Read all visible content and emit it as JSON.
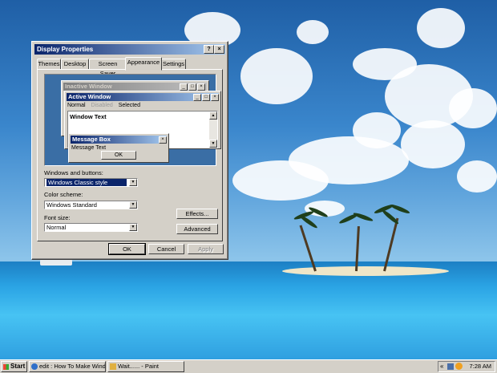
{
  "window": {
    "title": "Display Properties",
    "help_btn": "?",
    "close_btn": "×",
    "tabs": [
      "Themes",
      "Desktop",
      "Screen Saver",
      "Appearance",
      "Settings"
    ],
    "active_tab": "Appearance"
  },
  "preview": {
    "inactive_title": "Inactive Window",
    "active_title": "Active Window",
    "menu": [
      "Normal",
      "Disabled",
      "Selected"
    ],
    "window_text": "Window Text",
    "msgbox_title": "Message Box",
    "msgbox_text": "Message Text",
    "msgbox_ok": "OK"
  },
  "form": {
    "windows_buttons_label": "Windows and buttons:",
    "windows_buttons_value": "Windows Classic style",
    "color_scheme_label": "Color scheme:",
    "color_scheme_value": "Windows Standard",
    "font_size_label": "Font size:",
    "font_size_value": "Normal",
    "effects_btn": "Effects...",
    "advanced_btn": "Advanced"
  },
  "footer": {
    "ok": "OK",
    "cancel": "Cancel",
    "apply": "Apply"
  },
  "taskbar": {
    "start": "Start",
    "tasks": [
      "edit : How To Make Wind...",
      "Wait...... - Paint"
    ],
    "tray_expand": "«",
    "clock": "7:28 AM"
  }
}
